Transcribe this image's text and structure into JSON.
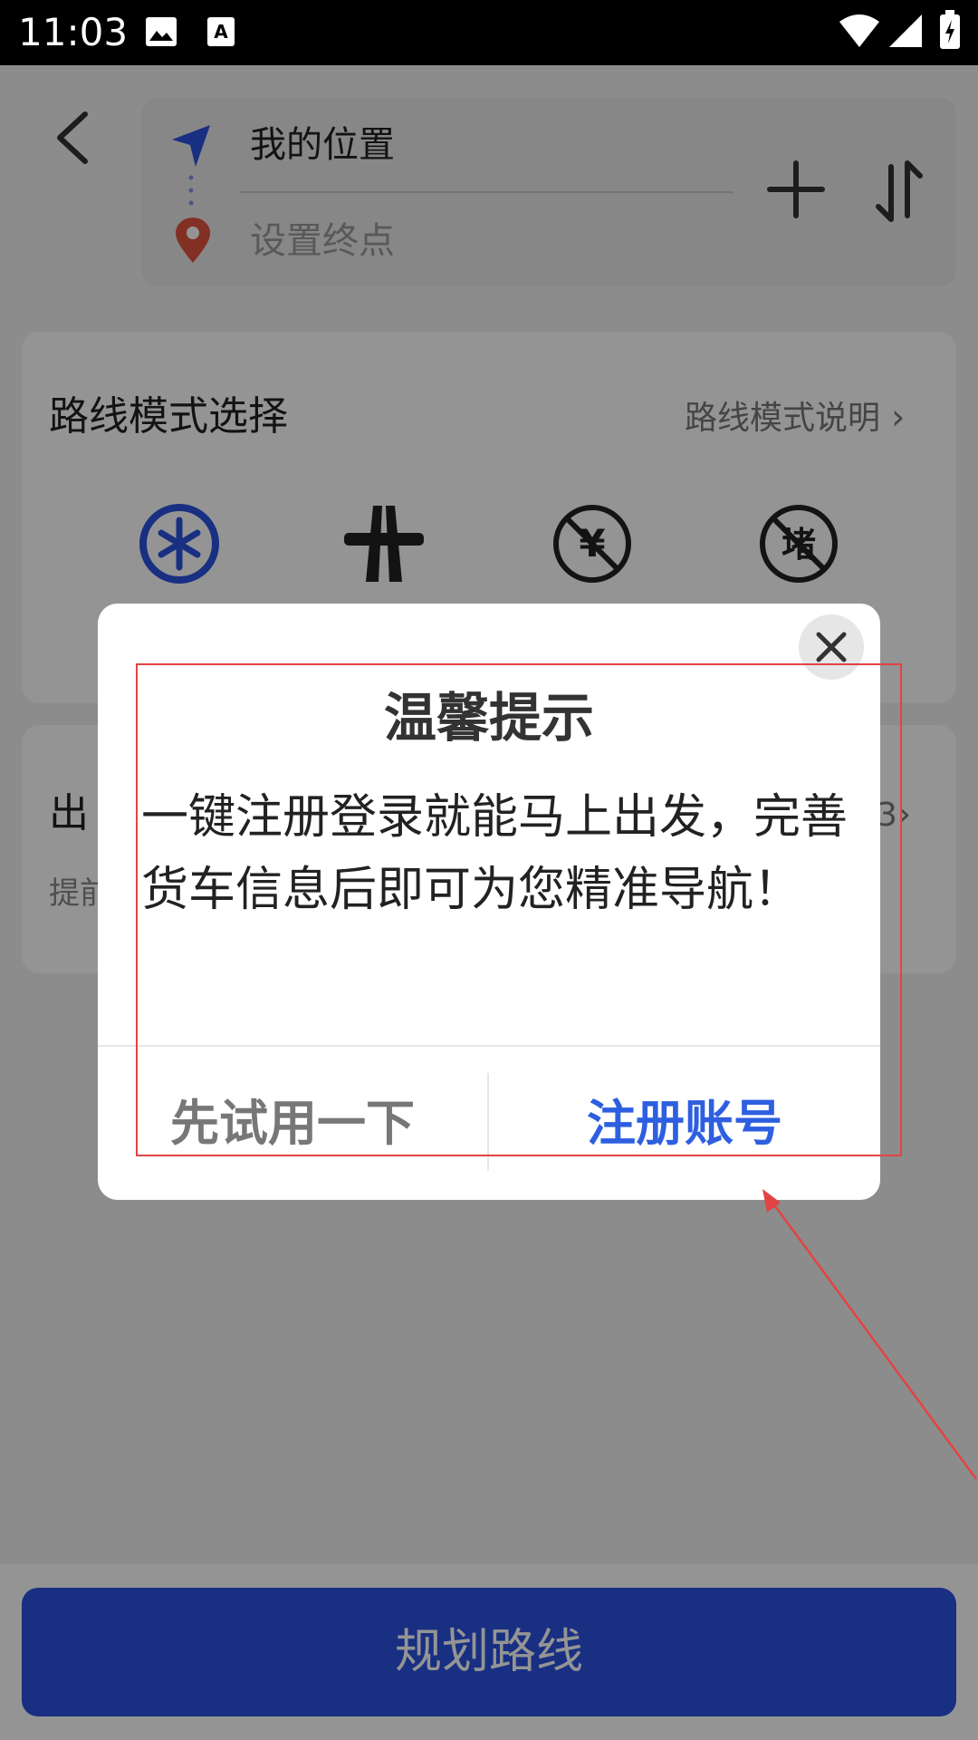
{
  "status_bar": {
    "time": "11:03",
    "icons": [
      "image-icon",
      "a-notification-icon",
      "wifi-icon",
      "signal-icon",
      "battery-charging-icon"
    ]
  },
  "header": {
    "from_text": "我的位置",
    "to_placeholder": "设置终点",
    "icons": [
      "back-arrow-icon",
      "navigation-arrow-icon",
      "location-pin-icon",
      "plus-icon",
      "swap-icon"
    ]
  },
  "route_mode": {
    "title": "路线模式选择",
    "help_link": "路线模式说明",
    "options": [
      {
        "icon": "recommend-icon",
        "glyph": "✱",
        "selected": true
      },
      {
        "icon": "highway-icon",
        "selected": false
      },
      {
        "icon": "avoid-toll-icon",
        "glyph": "¥",
        "selected": false
      },
      {
        "icon": "avoid-congestion-icon",
        "glyph": "堵",
        "selected": false
      }
    ]
  },
  "departure": {
    "title_partial": "出",
    "sub_partial": "提前",
    "value_partial": "3"
  },
  "bottom": {
    "plan_button": "规划路线"
  },
  "dialog": {
    "title": "温馨提示",
    "message": "一键注册登录就能马上出发，完善货车信息后即可为您精准导航！",
    "try_button": "先试用一下",
    "register_button": "注册账号"
  },
  "colors": {
    "accent": "#2a52e0",
    "annotation": "#e24444"
  }
}
